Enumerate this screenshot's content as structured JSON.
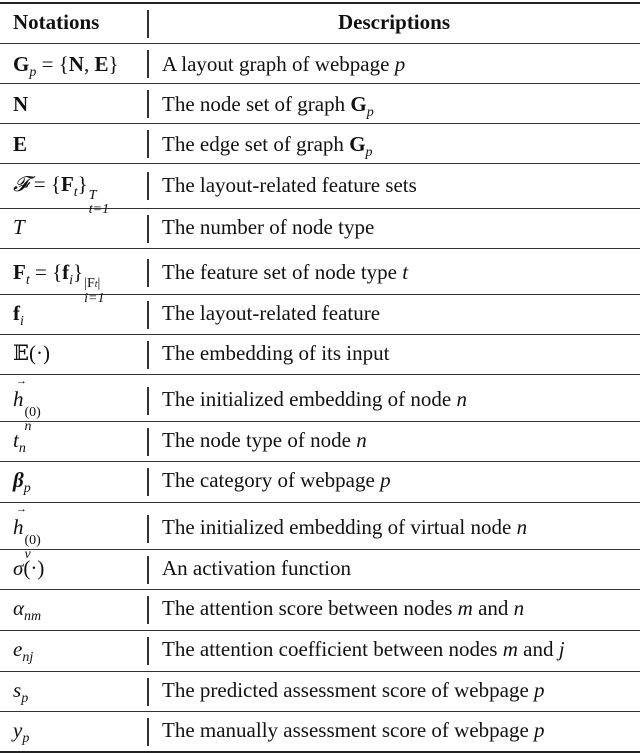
{
  "table": {
    "headers": {
      "notation": "Notations",
      "description": "Descriptions"
    },
    "rows": [
      {
        "notation_text": "G_p = {N, E}",
        "description": "A layout graph of webpage p"
      },
      {
        "notation_text": "N",
        "description": "The node set of graph G_p"
      },
      {
        "notation_text": "E",
        "description": "The edge set of graph G_p"
      },
      {
        "notation_text": "𝓕 = {F_t}_{t=1}^{T}",
        "description": "The layout-related feature sets"
      },
      {
        "notation_text": "T",
        "description": "The number of node type"
      },
      {
        "notation_text": "F_t = {f_i}_{i=1}^{|F_t|}",
        "description": "The feature set of node type t"
      },
      {
        "notation_text": "f_i",
        "description": "The layout-related feature"
      },
      {
        "notation_text": "𝔼(·)",
        "description": "The embedding of its input"
      },
      {
        "notation_text": "h⃗_n^(0)",
        "description": "The initialized embedding of node n"
      },
      {
        "notation_text": "t_n",
        "description": "The node type of node n"
      },
      {
        "notation_text": "β_p",
        "description": "The category of webpage p"
      },
      {
        "notation_text": "h⃗_v^(0)",
        "description": "The initialized embedding of virtual node n"
      },
      {
        "notation_text": "σ(·)",
        "description": "An activation function"
      },
      {
        "notation_text": "α_nm",
        "description": "The attention score between nodes m and n"
      },
      {
        "notation_text": "e_nj",
        "description": "The attention coefficient between nodes m and j"
      },
      {
        "notation_text": "s_p",
        "description": "The predicted assessment score of webpage p"
      },
      {
        "notation_text": "y_p",
        "description": "The manually assessment score of webpage p"
      }
    ],
    "parts": {
      "G": "G",
      "p": "p",
      "eq": " = ",
      "lbrace": "{",
      "rbrace": "}",
      "N": "N",
      "E": "E",
      "comma": ", ",
      "F_script": "𝓕",
      "F": "F",
      "t": "t",
      "T": "T",
      "t1": "t=1",
      "i1": "i=1",
      "Ft_abs": "|F",
      "abs_close": "|",
      "f": "f",
      "i": "i",
      "bbE": "𝔼",
      "dotarg": "(·)",
      "h": "h",
      "n": "n",
      "v": "v",
      "zero": "(0)",
      "beta": "β",
      "sigma": "σ",
      "alpha": "α",
      "nm": "nm",
      "e": "e",
      "nj": "nj",
      "s": "s",
      "y": "y",
      "m": "m",
      "j": "j",
      "d_graph": "A layout graph of webpage ",
      "d_nodeset": "The node set of graph ",
      "d_edgeset": "The edge set of graph ",
      "d_featset": "The feature set of node type ",
      "d_initemb": "The initialized embedding of node ",
      "d_nodetype": "The node type of node ",
      "d_category": "The category of webpage ",
      "d_virtual": "The initialized embedding of virtual node ",
      "d_attscore": "The attention score between nodes ",
      "d_attcoef": "The attention coefficient between nodes ",
      "d_and": " and ",
      "d_pred": "The predicted assessment score of webpage ",
      "d_manual": "The manually assessment score of webpage "
    }
  }
}
